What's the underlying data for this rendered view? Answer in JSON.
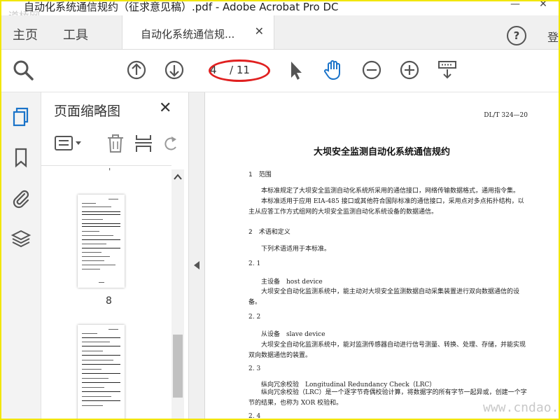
{
  "window": {
    "title": "自动化系统通信规约（征求意见稿）.pdf - Adobe Acrobat Pro DC",
    "watermark_top": "道桥网",
    "minimize": "—",
    "close": "✕"
  },
  "tabs": {
    "home": "主页",
    "tools": "工具",
    "doc": "自动化系统通信规...",
    "doc_close": "✕",
    "help": "?",
    "login": "登"
  },
  "toolbar": {
    "page_current": "4",
    "page_total": "/ 11"
  },
  "thumbnails": {
    "title": "页面缩略图",
    "close": "✕",
    "stray_mark": "'",
    "pages": [
      {
        "number": "8"
      }
    ]
  },
  "document": {
    "code": "DL/T 324—20",
    "title": "大坝安全监测自动化系统通信规约",
    "s1_head": "1　范围",
    "s1_p1": "本标准规定了大坝安全监测自动化系统所采用的通信接口，网络传输数据格式，通用指令集。",
    "s1_p2": "本标准适用于应用 EIA-485 接口或其他符合国际标准的通信接口，采用点对多点拓扑结构，以主从应答工作方式组网的大坝安全监测自动化系统设备的数据通信。",
    "s2_head": "2　术语和定义",
    "s2_p1": "下列术语适用于本标准。",
    "s21_num": "2. 1",
    "s21_term": "主设备　host device",
    "s21_def": "大坝安全自动化监测系统中，能主动对大坝安全监测数据自动采集装置进行双向数据通信的设备。",
    "s22_num": "2. 2",
    "s22_term": "从设备　slave device",
    "s22_def": "大坝安全自动化监测系统中，能对监测传感器自动进行信号测量、转换、处理、存储，并能实现双向数据通信的装置。",
    "s23_num": "2. 3",
    "s23_term": "纵向冗余校验　Longitudinal Redundancy Check（LRC）",
    "s23_def": "纵向冗余校验（LRC）是一个逐字节奇偶校验计算，将数据字的所有字节一起异或，创建一个字节的结果，也称为 XOR 校验和。",
    "s24_num": "2. 4"
  },
  "watermark_bottom": "www.cndao.com",
  "colors": {
    "accent_blue": "#1a73c9",
    "highlight_red": "#e02020",
    "frame_yellow": "#f2e600"
  }
}
